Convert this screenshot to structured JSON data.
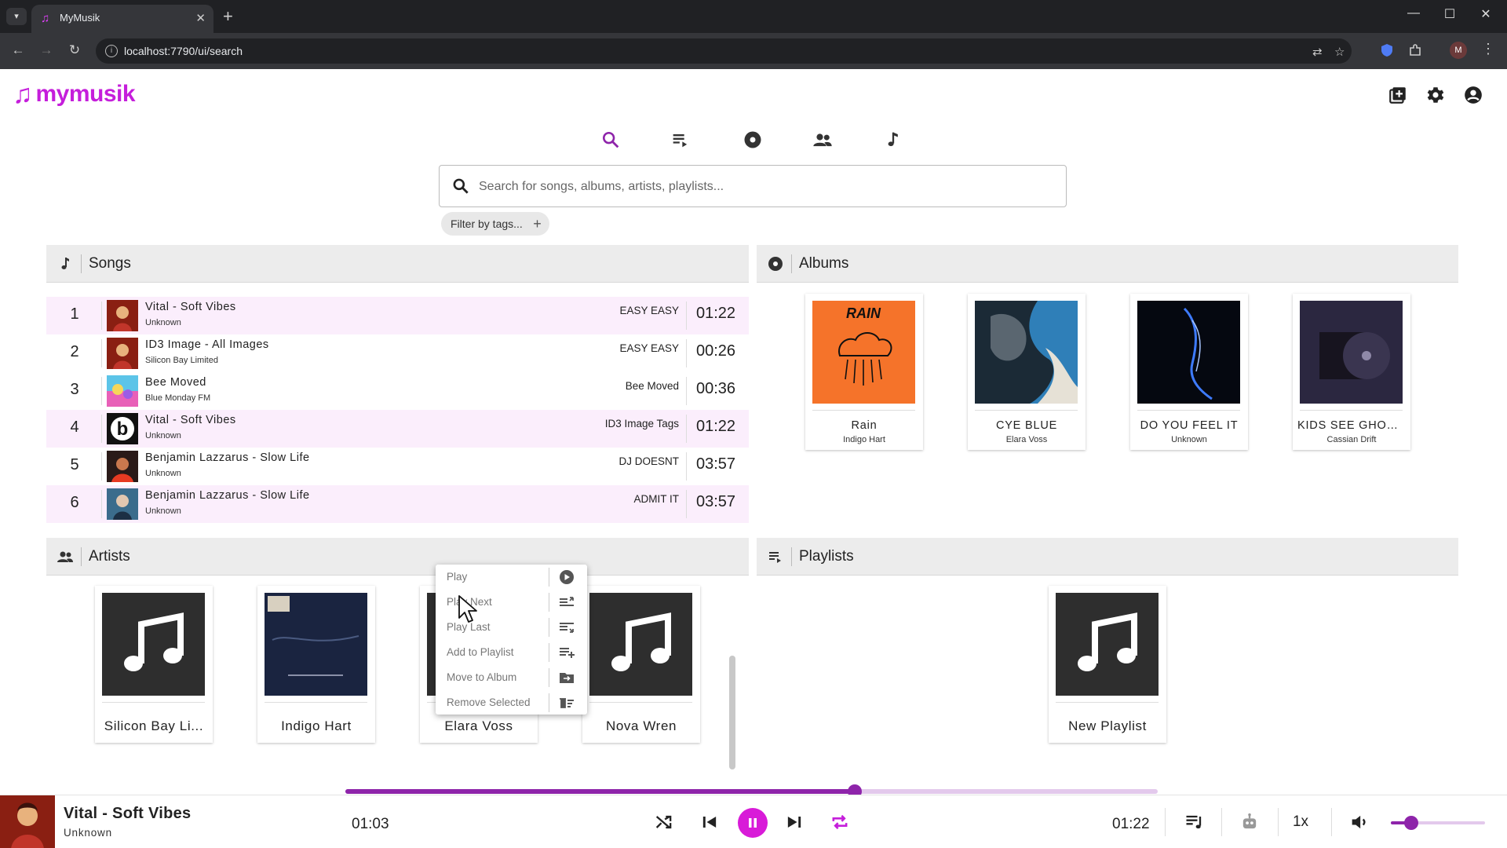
{
  "browser": {
    "tab_title": "MyMusik",
    "url": "localhost:7790/ui/search",
    "profile_initial": "M"
  },
  "app": {
    "logo_text": "mymusik",
    "header_icons": [
      "add-library-icon",
      "settings-icon",
      "account-icon"
    ],
    "nav_tabs": [
      "search-icon",
      "playlists-icon",
      "albums-icon",
      "artists-icon",
      "songs-icon"
    ],
    "accent_color": "#c51edb",
    "search": {
      "placeholder": "Search for songs, albums, artists, playlists..."
    },
    "filter_chip": "Filter by tags...",
    "filter_plus": "+"
  },
  "songs_panel": {
    "title": "Songs",
    "items": [
      {
        "num": "1",
        "title": "Vital - Soft Vibes",
        "artist": "Unknown",
        "tag": "EASY EASY",
        "duration": "01:22"
      },
      {
        "num": "2",
        "title": "ID3 Image - All Images",
        "artist": "Silicon Bay Limited",
        "tag": "EASY EASY",
        "duration": "00:26"
      },
      {
        "num": "3",
        "title": "Bee Moved",
        "artist": "Blue Monday FM",
        "tag": "Bee Moved",
        "duration": "00:36"
      },
      {
        "num": "4",
        "title": "Vital - Soft Vibes",
        "artist": "Unknown",
        "tag": "ID3 Image Tags",
        "duration": "01:22"
      },
      {
        "num": "5",
        "title": "Benjamin Lazzarus - Slow Life",
        "artist": "Unknown",
        "tag": "DJ DOESNT",
        "duration": "03:57"
      },
      {
        "num": "6",
        "title": "Benjamin Lazzarus - Slow Life",
        "artist": "Unknown",
        "tag": "ADMIT IT",
        "duration": "03:57"
      }
    ]
  },
  "albums_panel": {
    "title": "Albums",
    "items": [
      {
        "name": "Rain",
        "artist": "Indigo Hart",
        "cover_text": "RAIN"
      },
      {
        "name": "CYE BLUE",
        "artist": "Elara Voss"
      },
      {
        "name": "DO YOU FEEL IT",
        "artist": "Unknown"
      },
      {
        "name": "KIDS SEE GHOS...",
        "artist": "Cassian Drift"
      }
    ]
  },
  "artists_panel": {
    "title": "Artists",
    "items": [
      {
        "name": "Silicon Bay Li..."
      },
      {
        "name": "Indigo Hart"
      },
      {
        "name": "Elara Voss"
      },
      {
        "name": "Nova Wren"
      }
    ]
  },
  "playlists_panel": {
    "title": "Playlists",
    "items": [
      {
        "name": "New Playlist"
      }
    ]
  },
  "context_menu": {
    "items": [
      {
        "label": "Play",
        "icon": "play-circle-icon"
      },
      {
        "label": "Play Next",
        "icon": "queue-next-icon"
      },
      {
        "label": "Play Last",
        "icon": "queue-last-icon"
      },
      {
        "label": "Add to Playlist",
        "icon": "playlist-add-icon"
      },
      {
        "label": "Move to Album",
        "icon": "folder-move-icon"
      },
      {
        "label": "Remove Selected",
        "icon": "delete-sweep-icon"
      }
    ]
  },
  "player": {
    "title": "Vital - Soft Vibes",
    "artist": "Unknown",
    "elapsed": "01:03",
    "total": "01:22",
    "progress_fraction": 0.627,
    "speed": "1x",
    "volume_fraction": 0.22
  }
}
